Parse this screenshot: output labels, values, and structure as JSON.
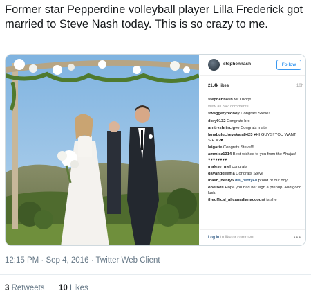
{
  "tweet": {
    "text": "Former star Pepperdine volleyball player Lilla Frederick got married to Steve Nash today. This is so crazy to me.",
    "timestamp": "12:15 PM · Sep 4, 2016 · Twitter Web Client",
    "retweets_count": "3",
    "retweets_label": "Retweets",
    "likes_count": "10",
    "likes_label": "Likes"
  },
  "instagram": {
    "username": "stephennash",
    "follow_label": "Follow",
    "likes": "21.4k likes",
    "age": "10h",
    "caption": {
      "user": "stephennash",
      "text": "Mr Lucky!"
    },
    "view_all": "view all 347 comments",
    "comments": [
      {
        "user": "swaggeryoloboy",
        "text": "Congrats Steve!"
      },
      {
        "user": "dory9132",
        "text": "Congrats bro"
      },
      {
        "user": "arntrvshrincigve",
        "text": "Congrats mate"
      },
      {
        "user": "lanabuluchevskaia8423",
        "text": "♥HI GUYS! YOU WANT S.E.X?♥"
      },
      {
        "user": "laigarie",
        "text": "Congrats Steve!!!"
      },
      {
        "user": "ammiez1314",
        "text": "Best wishes to you from the Ahujas!♥♥♥♥♥♥♥♥"
      },
      {
        "user": "malese_mel",
        "text": "congrats"
      },
      {
        "user": "gavandgeema",
        "text": "Congrats Steve"
      },
      {
        "user": "mash_henry5",
        "mention": "dia_henry40",
        "text": "proud of our boy"
      },
      {
        "user": "onerods",
        "text": "Hope you had her sign a prenup. And good luck."
      },
      {
        "user": "theoffical_alicanadianaccount",
        "text": "is she"
      }
    ],
    "footer_login": "Log in",
    "footer_rest": "to like or comment.",
    "more": "•••"
  },
  "colors": {
    "text": "#14171a",
    "secondary": "#657786",
    "ig_blue": "#3897f0",
    "ig_link": "#003569"
  }
}
